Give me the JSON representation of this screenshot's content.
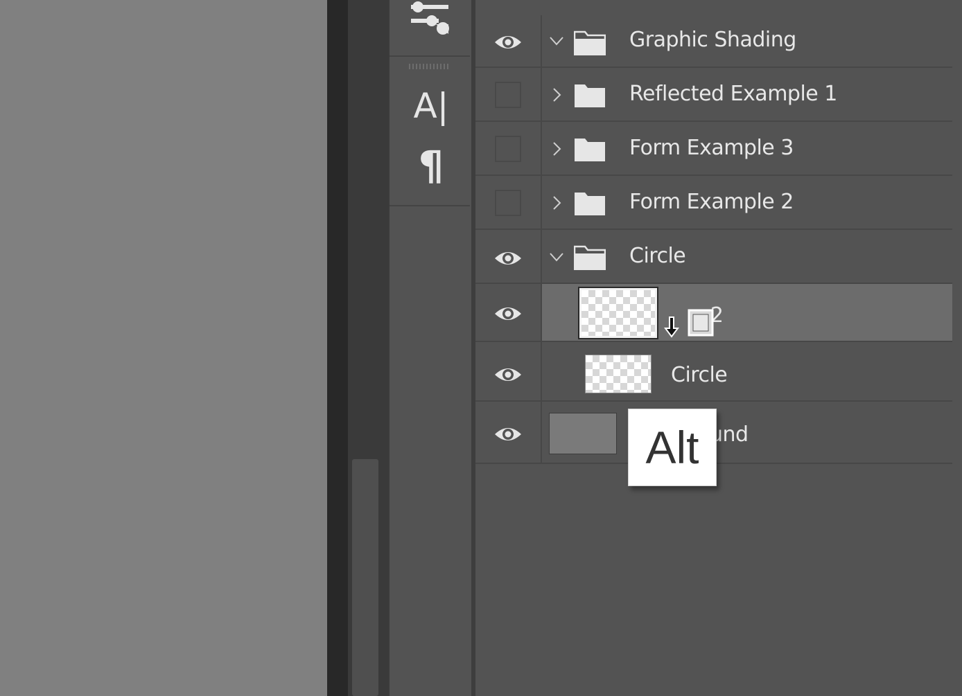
{
  "layers": [
    {
      "name": "Graphic Shading",
      "visible": true,
      "type": "group",
      "expanded": true
    },
    {
      "name": "Reflected Example 1",
      "visible": false,
      "type": "group",
      "expanded": false
    },
    {
      "name": "Form Example 3",
      "visible": false,
      "type": "group",
      "expanded": false
    },
    {
      "name": "Form Example 2",
      "visible": false,
      "type": "group",
      "expanded": false
    },
    {
      "name": "Circle",
      "visible": true,
      "type": "group",
      "expanded": true
    },
    {
      "name": "Layer 2",
      "visible": true,
      "type": "layer",
      "selected": true
    },
    {
      "name": "Circle",
      "visible": true,
      "type": "layer"
    },
    {
      "name": "Background",
      "visible": true,
      "type": "layer"
    }
  ],
  "layer_label_visible_text": {
    "layer2": "r 2",
    "background": "und"
  },
  "tools": {
    "type_tool_glyph": "A|",
    "paragraph_glyph": "¶"
  },
  "tooltip": {
    "text": "Alt"
  },
  "icons": {
    "adjustments": "sliders-icon",
    "eye": "eye-icon",
    "folder": "folder-icon",
    "chevron_down": "chevron-down-icon",
    "chevron_right": "chevron-right-icon",
    "cursor": "clip-to-layer-cursor-icon"
  },
  "colors": {
    "panel_bg": "#535353",
    "canvas_bg": "#808080",
    "selected_row": "#6c6c6c",
    "text": "#e8e8e8"
  }
}
